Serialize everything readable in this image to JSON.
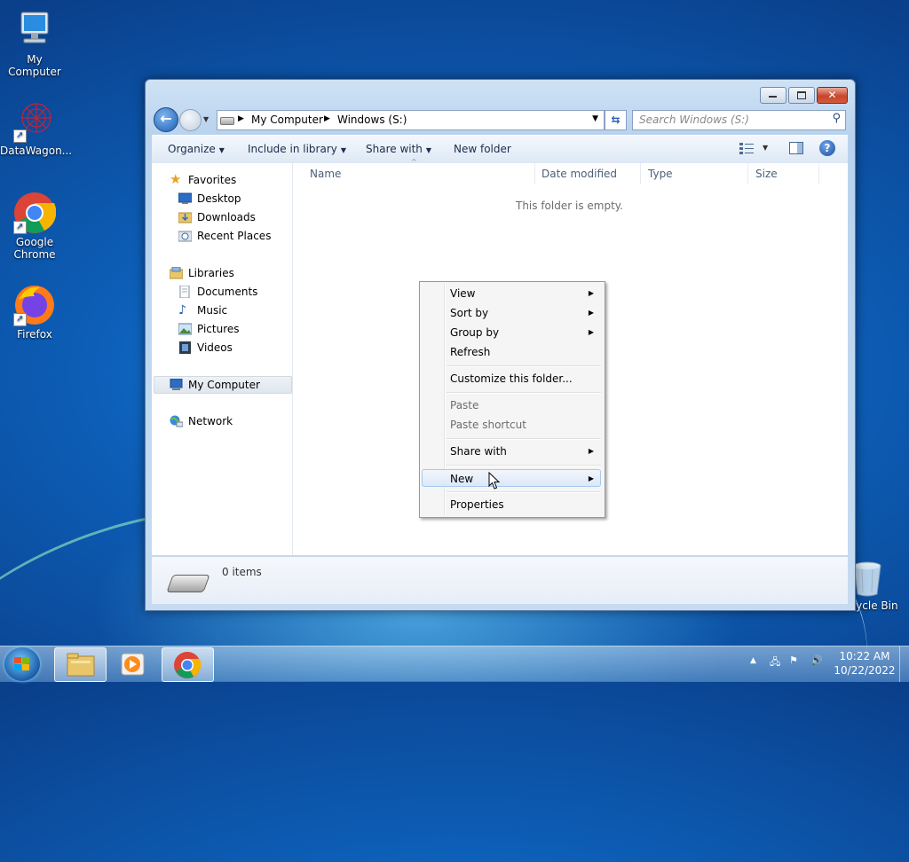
{
  "desktop": {
    "icons": [
      {
        "label": "My Computer",
        "icon": "computer-icon"
      },
      {
        "label": "DataWagon...",
        "icon": "datawagon-icon"
      },
      {
        "label": "Google Chrome",
        "icon": "chrome-icon"
      },
      {
        "label": "Firefox",
        "icon": "firefox-icon"
      },
      {
        "label": "Recycle Bin",
        "icon": "recycle-bin-icon"
      }
    ]
  },
  "window": {
    "address": {
      "crumbs": [
        "My Computer",
        "Windows (S:)"
      ]
    },
    "search_placeholder": "Search Windows (S:)",
    "toolbar": {
      "organize": "Organize",
      "include_in_library": "Include in library",
      "share_with": "Share with",
      "new_folder": "New folder"
    },
    "nav": {
      "favorites": "Favorites",
      "desktop": "Desktop",
      "downloads": "Downloads",
      "recent_places": "Recent Places",
      "libraries": "Libraries",
      "documents": "Documents",
      "music": "Music",
      "pictures": "Pictures",
      "videos": "Videos",
      "my_computer": "My Computer",
      "network": "Network"
    },
    "columns": [
      "Name",
      "Date modified",
      "Type",
      "Size"
    ],
    "empty_message": "This folder is empty.",
    "details": {
      "items": "0 items"
    }
  },
  "context_menu": {
    "items": [
      {
        "label": "View",
        "submenu": true
      },
      {
        "label": "Sort by",
        "submenu": true
      },
      {
        "label": "Group by",
        "submenu": true
      },
      {
        "label": "Refresh"
      },
      {
        "label": "Customize this folder..."
      },
      {
        "label": "Paste",
        "disabled": true
      },
      {
        "label": "Paste shortcut",
        "disabled": true
      },
      {
        "label": "Share with",
        "submenu": true
      },
      {
        "label": "New",
        "submenu": true,
        "highlighted": true
      },
      {
        "label": "Properties"
      }
    ]
  },
  "taskbar": {
    "clock": {
      "time": "10:22 AM",
      "date": "10/22/2022"
    }
  },
  "colors": {
    "accent": "#1b5da6",
    "menu_highlight": "#dce8f8",
    "close_button": "#c7462b"
  }
}
